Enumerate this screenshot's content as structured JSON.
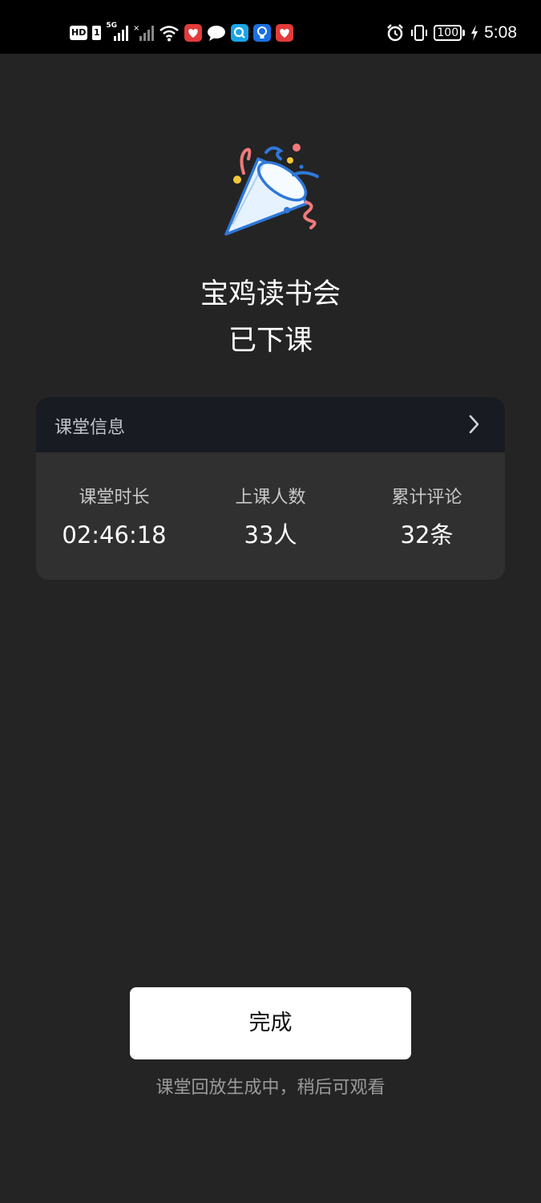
{
  "status_bar": {
    "hd": "HD",
    "sim": "1",
    "network": "5G",
    "battery": "100",
    "time": "5:08",
    "icons": [
      "signal-icon",
      "signal-no-service-icon",
      "wifi-icon",
      "app-notification-icon",
      "message-icon",
      "search-app-icon",
      "bulb-app-icon",
      "app-notification-icon",
      "alarm-icon",
      "vibrate-icon",
      "battery-icon",
      "charging-icon"
    ]
  },
  "hero": {
    "icon": "party-popper-icon",
    "title": "宝鸡读书会",
    "subtitle": "已下课"
  },
  "info_card": {
    "header": "课堂信息",
    "stats": [
      {
        "label": "课堂时长",
        "value": "02:46:18"
      },
      {
        "label": "上课人数",
        "value": "33人"
      },
      {
        "label": "累计评论",
        "value": "32条"
      }
    ]
  },
  "footer": {
    "done_label": "完成",
    "note": "课堂回放生成中，稍后可观看"
  },
  "colors": {
    "background": "#242424",
    "card": "#303030",
    "card_header": "#181b22",
    "button": "#ffffff"
  }
}
